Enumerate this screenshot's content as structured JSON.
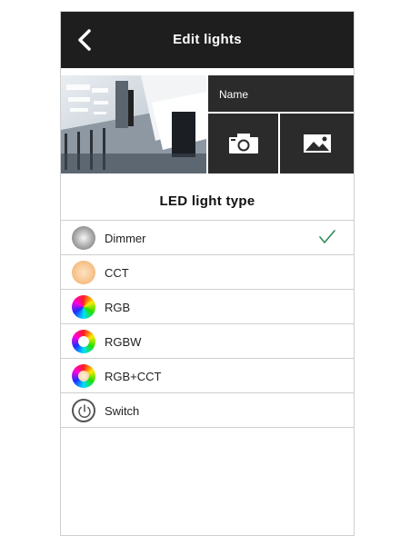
{
  "header": {
    "title": "Edit lights",
    "back_icon": "chevron-left-icon"
  },
  "name_panel": {
    "label": "Name",
    "camera_icon": "camera-icon",
    "gallery_icon": "image-icon"
  },
  "section_title": "LED light type",
  "light_types": [
    {
      "label": "Dimmer",
      "icon": "dimmer-icon",
      "selected": true
    },
    {
      "label": "CCT",
      "icon": "cct-icon",
      "selected": false
    },
    {
      "label": "RGB",
      "icon": "rgb-icon",
      "selected": false
    },
    {
      "label": "RGBW",
      "icon": "rgbw-icon",
      "selected": false
    },
    {
      "label": "RGB+CCT",
      "icon": "rgb-cct-icon",
      "selected": false
    },
    {
      "label": "Switch",
      "icon": "power-icon",
      "selected": false
    }
  ],
  "colors": {
    "header_bg": "#1e1e1e",
    "panel_bg": "#2b2b2b",
    "check": "#2e8b57"
  }
}
